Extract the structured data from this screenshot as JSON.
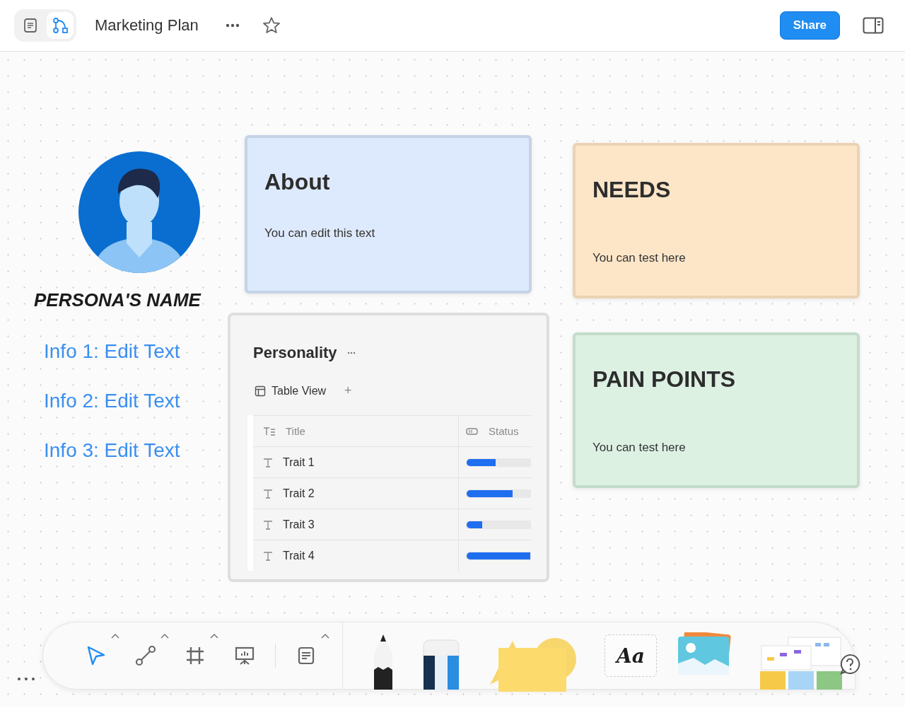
{
  "header": {
    "view_tabs": [
      {
        "kind": "doc",
        "selected": false
      },
      {
        "kind": "board",
        "selected": true
      }
    ],
    "title": "Marketing Plan",
    "share": "Share"
  },
  "persona": {
    "name": "PERSONA'S NAME",
    "info": [
      "Info 1: Edit Text",
      "Info 2: Edit Text",
      "Info 3: Edit Text"
    ]
  },
  "notes": [
    {
      "title": "About",
      "body": "You can edit this text",
      "color": "#dde9fc"
    },
    {
      "title": "NEEDS",
      "body": "You can test here",
      "color": "#fde6c8"
    },
    {
      "title": "PAIN POINTS",
      "body": "You can test here",
      "color": "#ddf1e3"
    }
  ],
  "database": {
    "title": "Personality",
    "view": "Table View",
    "add": "+",
    "columns": [
      "Title",
      "Status"
    ],
    "rows": [
      {
        "title": "Trait 1",
        "level": 0.45
      },
      {
        "title": "Trait 2",
        "level": 0.72
      },
      {
        "title": "Trait 3",
        "level": 0.24
      },
      {
        "title": "Trait 4",
        "level": 1
      }
    ]
  },
  "toolbar": {
    "tools": [
      {
        "kind": "pointer",
        "selected": true
      },
      {
        "kind": "connector",
        "selected": false
      },
      {
        "kind": "frame",
        "selected": false
      },
      {
        "kind": "presentation",
        "selected": false
      },
      {
        "kind": "note",
        "selected": false
      }
    ],
    "text_tool": "Aa"
  }
}
